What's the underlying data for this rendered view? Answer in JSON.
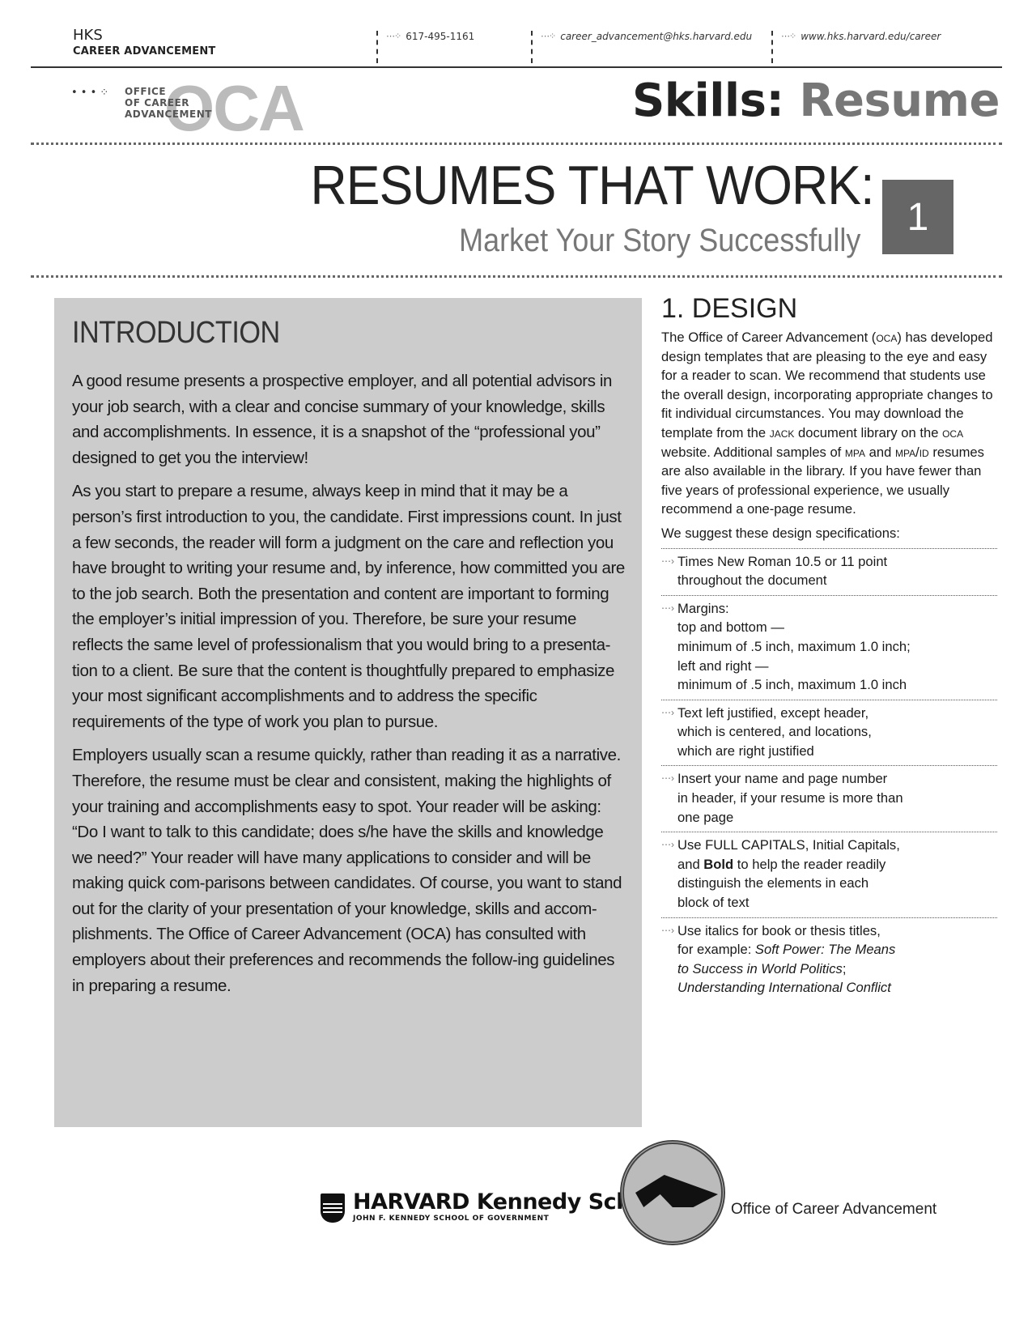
{
  "header": {
    "org_line1": "HKS",
    "org_line2": "CAREER ADVANCEMENT",
    "contacts": [
      {
        "icon": "arrow-dots-icon",
        "text": "617-495-1161"
      },
      {
        "icon": "arrow-dots-icon",
        "text": "career_advancement@hks.harvard.edu"
      },
      {
        "icon": "arrow-dots-icon",
        "text": "www.hks.harvard.edu/career"
      }
    ]
  },
  "logo": {
    "big": "OCA",
    "small_l1": "OFFICE",
    "small_l2": "OF CAREER",
    "small_l3": "ADVANCEMENT",
    "dots": "• • • ⁘"
  },
  "section_title": {
    "part1": "Skills:",
    "part2": "Resume"
  },
  "banner": {
    "title": "RESUMES THAT WORK:",
    "subtitle": "Market Your Story Successfully",
    "number": "1"
  },
  "intro": {
    "heading": "INTRODUCTION",
    "paragraphs": [
      "A good resume presents a prospective employer, and all potential advisors in your job search, with a clear and concise summary of your knowledge, skills and accomplishments. In essence, it is a snapshot of the “professional you” designed to get you the interview!",
      "As you start to prepare a resume, always keep in mind that it may be a person’s first introduction to you, the candidate. First impressions count. In just a few seconds, the reader will form a judgment on the care and reflection you have brought to writing your resume and, by inference, how committed you are to the job search. Both the presentation and content are important to forming the employer’s initial impression of you. Therefore, be sure your resume reflects the same level of professionalism that you would bring to a presenta-tion to a client. Be sure that the content is thoughtfully prepared to emphasize your most significant accomplishments and to address the specific requirements of the type of work you plan to pursue.",
      "Employers usually scan a resume quickly, rather than reading it as a narrative. Therefore, the resume must be clear and consistent, making the highlights of your training and accomplishments easy to spot. Your reader will be asking: “Do I want to talk to this candidate; does s/he have the skills and knowledge we need?” Your reader will have many applications to consider and will be making quick com-parisons between candidates. Of course, you want to stand out for the clarity of your presentation of your knowledge, skills and accom-plishments. The Office of Career Advancement (OCA) has consulted with employers about their preferences and recommends the follow-ing guidelines in preparing a resume."
    ]
  },
  "design": {
    "heading": "1. DESIGN",
    "p1_a": "The Office of Career Advancement (",
    "p1_oca": "OCA",
    "p1_b": ") has developed design templates that are pleasing to the eye and easy for a reader to scan. We recommend that students use the overall design, incorporating appropriate changes to fit individual circumstances. You may download the template from the ",
    "p1_jack": "JACK",
    "p1_c": " document library on the ",
    "p1_oca2": "OCA",
    "p1_d": " website. Additional samples of ",
    "p1_mpa": "MPA",
    "p1_e": " and ",
    "p1_mpaid": "MPA/ID",
    "p1_f": " resumes are also available in the library. If you have fewer than five years of professional experience, we usually recommend a one-page resume.",
    "intro_line": "We suggest these design specifications:",
    "specs": [
      {
        "lines": [
          "Times New Roman 10.5 or 11 point",
          "throughout the document"
        ]
      },
      {
        "lines": [
          "Margins:",
          "top and bottom —",
          "minimum of .5 inch, maximum 1.0 inch;",
          "left and right —",
          "minimum of .5 inch, maximum 1.0 inch"
        ]
      },
      {
        "lines": [
          "Text left justified, except header,",
          "which is centered, and locations,",
          "which are right justified"
        ]
      },
      {
        "lines": [
          "Insert your name and page number",
          "in header, if your resume is more than",
          "one page"
        ]
      }
    ],
    "spec5": {
      "a": "Use FULL CAPITALS, Initial Capitals,",
      "b1": "and ",
      "bold": "Bold",
      "b2": " to help the reader readily",
      "c": "distinguish the elements in each",
      "d": "block of text"
    },
    "spec6": {
      "a": "Use italics for book or thesis titles,",
      "b1": "for example: ",
      "i1": "Soft Power: The Means",
      "i2": "to Success in World Politics",
      "semi": ";",
      "i3": "Understanding International Conflict"
    },
    "arrow": "⋯›"
  },
  "footer": {
    "hks_name": "HARVARD Kennedy School",
    "hks_sub": "JOHN F. KENNEDY SCHOOL OF GOVERNMENT",
    "oca_text": "Office of Career Advancement"
  }
}
